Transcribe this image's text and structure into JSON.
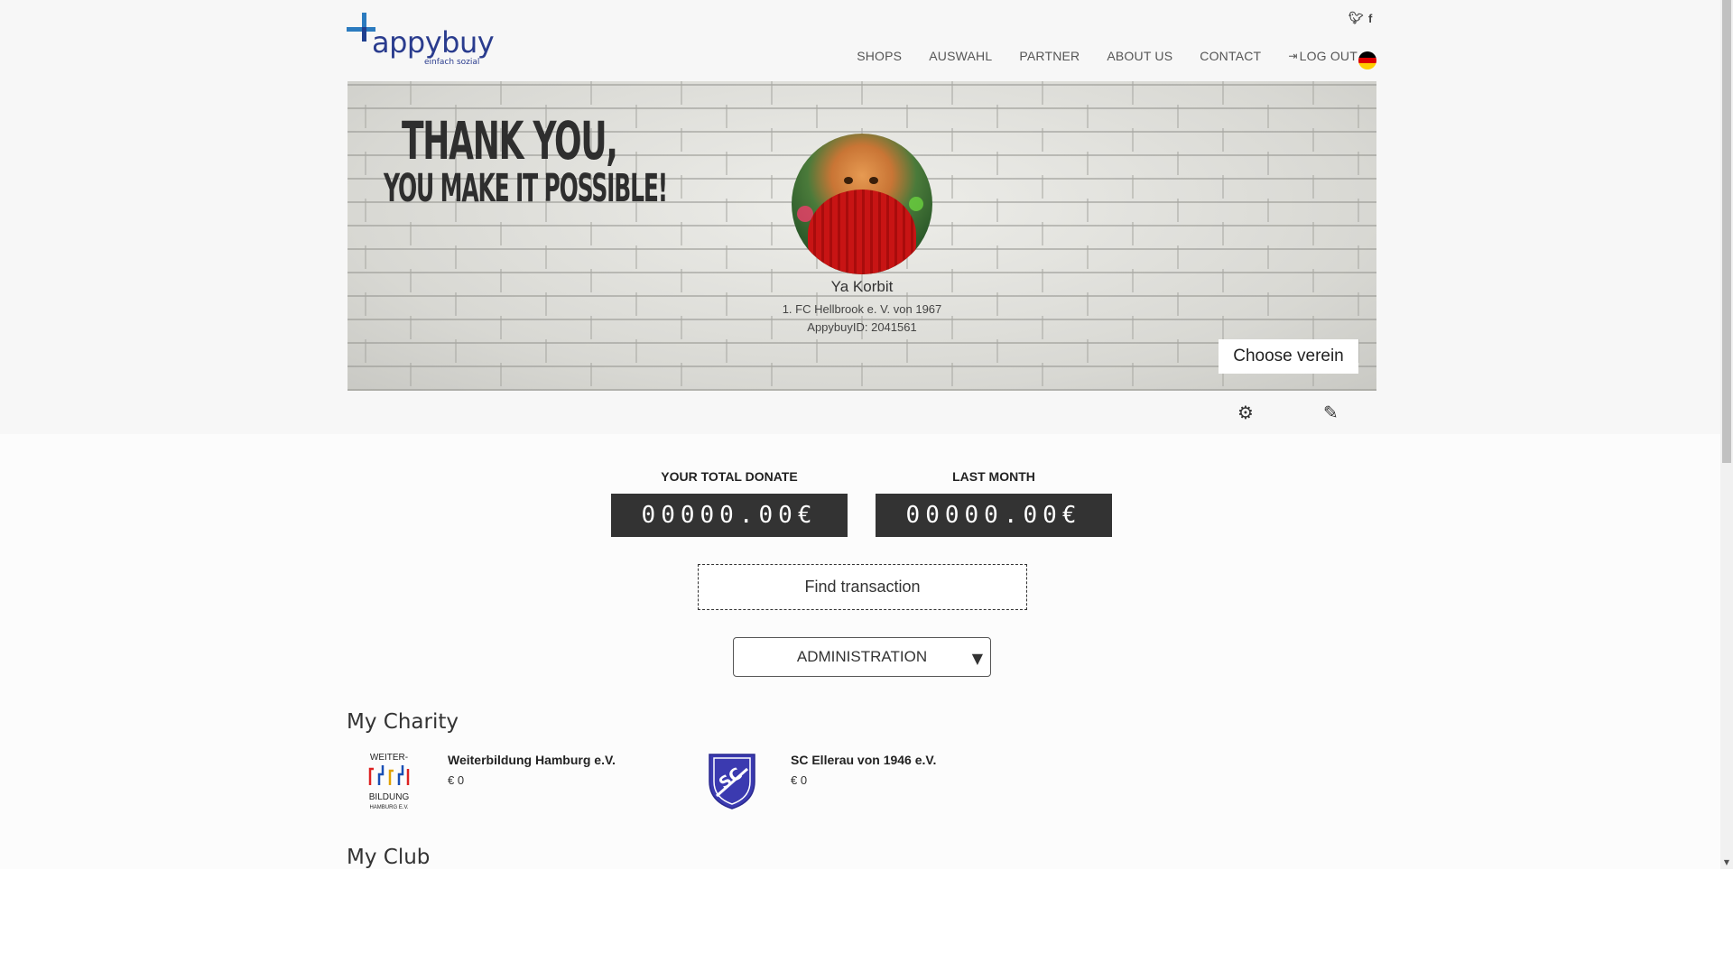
{
  "brand": {
    "name": "appybuy",
    "tagline": "einfach sozial"
  },
  "social": {
    "twitter": "twitter-icon",
    "facebook": "facebook-icon"
  },
  "nav": [
    {
      "label": "SHOPS"
    },
    {
      "label": "AUSWAHL"
    },
    {
      "label": "PARTNER"
    },
    {
      "label": "ABOUT US"
    },
    {
      "label": "CONTACT"
    },
    {
      "label": "LOG OUT"
    }
  ],
  "language": "German",
  "hero": {
    "headline1": "THANK YOU,",
    "headline2": "YOU MAKE IT POSSIBLE!",
    "user_name": "Ya Korbit",
    "club": "1. FC Hellbrook e. V. von 1967",
    "appybuy_id": "AppybuyID: 2041561",
    "choose_button": "Choose verein"
  },
  "totals": {
    "total_label": "YOUR TOTAL DONATE",
    "total_value": "00000.00€",
    "month_label": "LAST MONTH",
    "month_value": "00000.00€"
  },
  "find_button": "Find transaction",
  "admin_select": {
    "selected": "ADMINISTRATION"
  },
  "my_charity": {
    "title": "My Charity",
    "items": [
      {
        "name": "Weiterbildung Hamburg e.V.",
        "amount": "€ 0",
        "logo_text_top": "WEITER-",
        "logo_text_bottom": "BILDUNG",
        "logo_text_small": "HAMBURG E.V."
      },
      {
        "name": "SC Ellerau von 1946 e.V.",
        "amount": "€ 0"
      }
    ]
  },
  "my_club": {
    "title": "My Club"
  },
  "colors": {
    "brand_blue": "#2a3c8e",
    "accent_blue": "#2b7bbf",
    "dark_box": "#333333",
    "sc_purple": "#3b3ab0"
  }
}
